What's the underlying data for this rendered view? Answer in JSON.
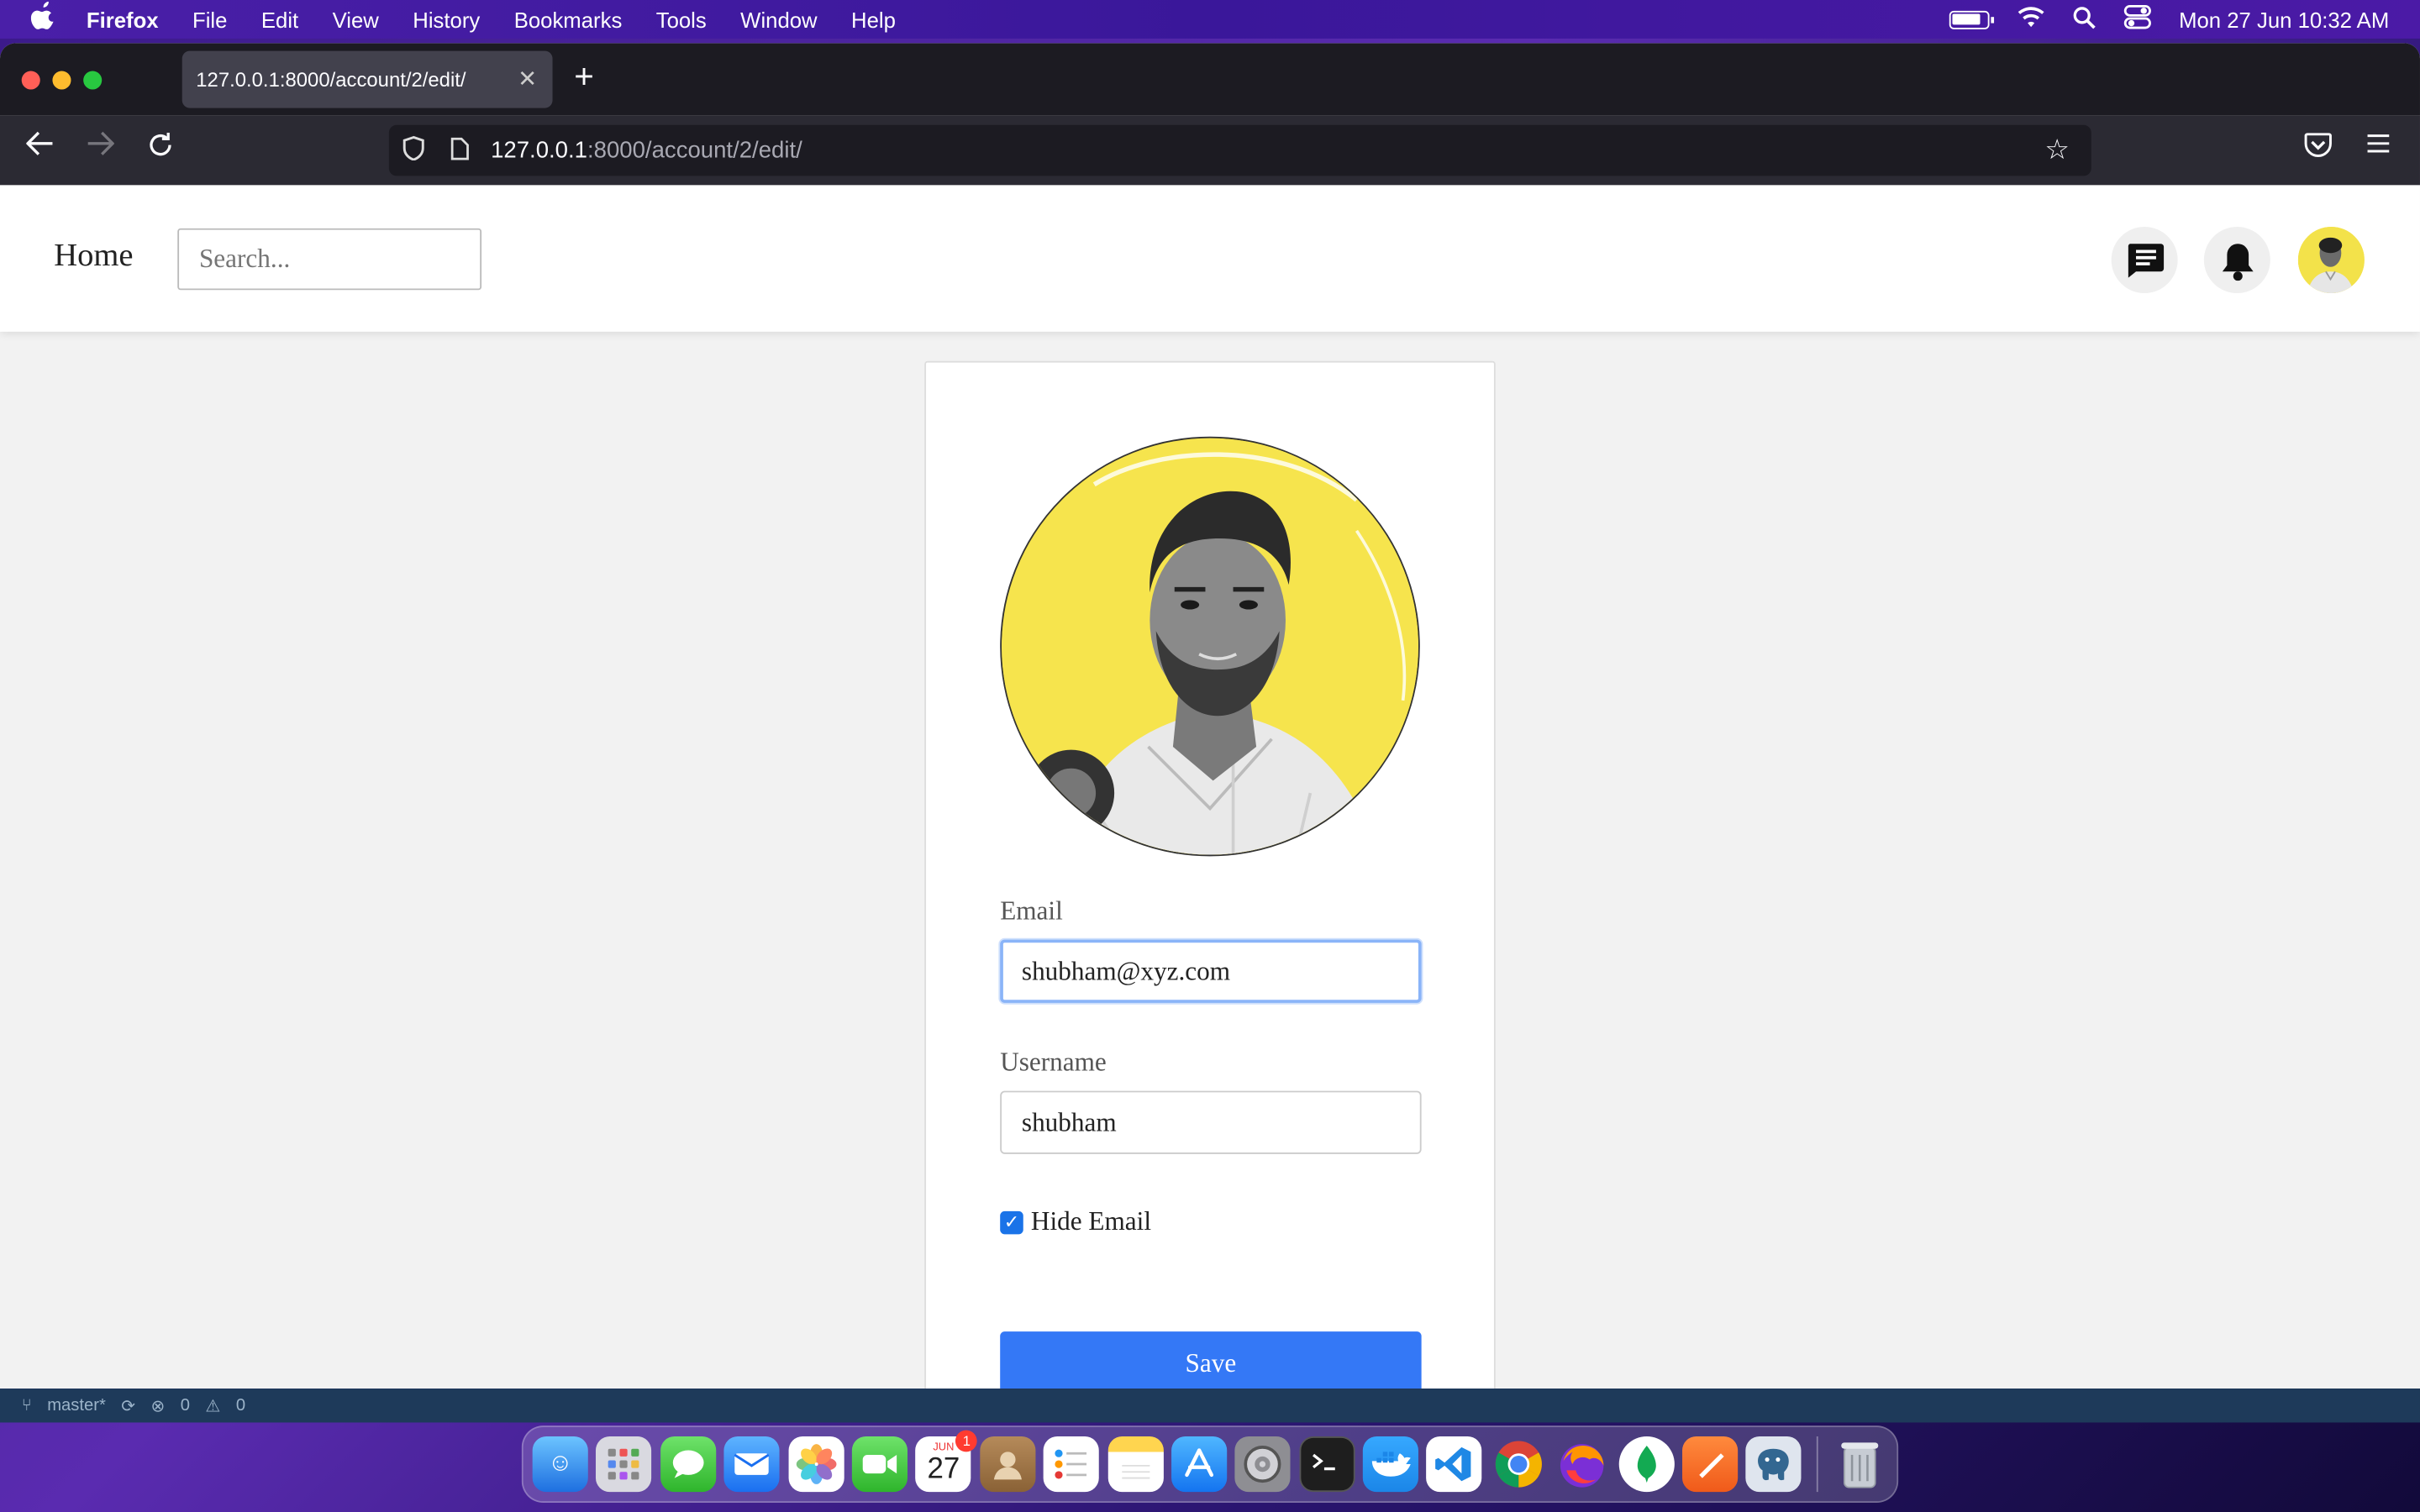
{
  "menubar": {
    "app": "Firefox",
    "items": [
      "File",
      "Edit",
      "View",
      "History",
      "Bookmarks",
      "Tools",
      "Window",
      "Help"
    ],
    "datetime": "Mon 27 Jun  10:32 AM"
  },
  "browser": {
    "tab_title": "127.0.0.1:8000/account/2/edit/",
    "url_host": "127.0.0.1",
    "url_path": ":8000/account/2/edit/"
  },
  "site": {
    "home_label": "Home",
    "search_placeholder": "Search..."
  },
  "form": {
    "email_label": "Email",
    "email_value": "shubham@xyz.com",
    "username_label": "Username",
    "username_value": "shubham",
    "hide_email_label": "Hide Email",
    "hide_email_checked": true,
    "save_label": "Save"
  },
  "statusbar": {
    "branch": "master*",
    "problems": "0",
    "warnings": "0"
  },
  "dock": {
    "calendar_month": "JUN",
    "calendar_day": "27",
    "calendar_badge": "1"
  }
}
